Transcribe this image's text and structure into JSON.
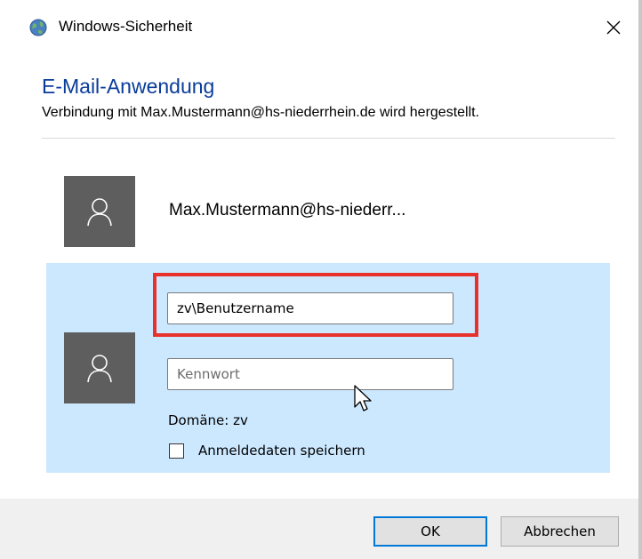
{
  "window": {
    "title": "Windows-Sicherheit",
    "icon": "globe-icon"
  },
  "header": {
    "app_name": "E-Mail-Anwendung",
    "message": "Verbindung mit Max.Mustermann@hs-niederrhein.de wird hergestellt."
  },
  "accounts": [
    {
      "name": "Max.Mustermann@hs-niederr...",
      "icon": "user-icon"
    },
    {
      "icon": "user-icon",
      "username": {
        "value": "zv\\Benutzername",
        "placeholder": ""
      },
      "password": {
        "value": "",
        "placeholder": "Kennwort"
      },
      "domain": "Domäne: zv",
      "remember": {
        "label": "Anmeldedaten speichern",
        "checked": false
      },
      "selected": true
    }
  ],
  "buttons": {
    "ok": "OK",
    "cancel": "Abbrechen"
  },
  "colors": {
    "heading": "#0a3c9a",
    "selected_bg": "#cce8ff",
    "avatar_bg": "#5e5e5e",
    "highlight": "#e8312b",
    "ok_border": "#0078d7"
  }
}
